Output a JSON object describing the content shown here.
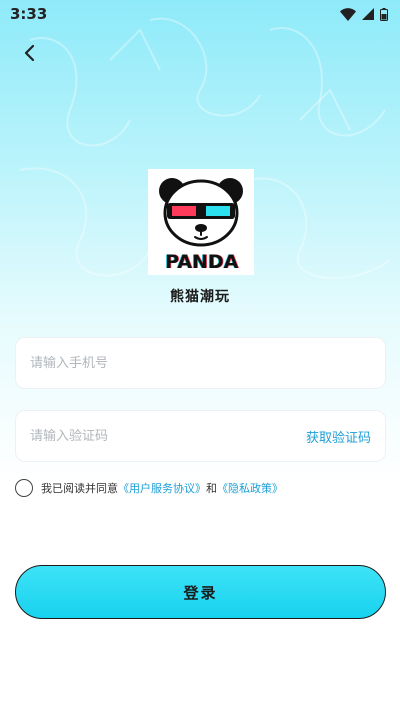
{
  "status_bar": {
    "time": "3:33",
    "icons": [
      "wifi-icon",
      "signal-icon",
      "battery-icon"
    ]
  },
  "header": {
    "back_icon": "chevron-left-icon"
  },
  "logo": {
    "text": "PANDA"
  },
  "app_name": "熊猫潮玩",
  "phone_field": {
    "placeholder": "请输入手机号",
    "value": ""
  },
  "code_field": {
    "placeholder": "请输入验证码",
    "value": "",
    "get_code_label": "获取验证码"
  },
  "agreement": {
    "checked": false,
    "prefix": "我已阅读并同意",
    "terms_link": "《用户服务协议》",
    "conjunction": "和",
    "privacy_link": "《隐私政策》"
  },
  "login_button": {
    "label": "登录"
  },
  "colors": {
    "accent": "#1d9fd6",
    "button": "#18d2ee",
    "background_top": "#8eeaf9"
  }
}
